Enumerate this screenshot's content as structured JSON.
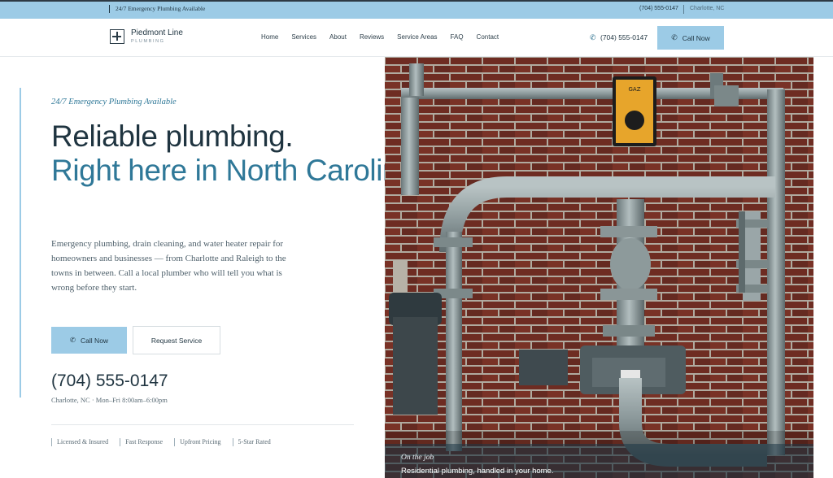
{
  "topbar": {
    "announcement": "24/7 Emergency Plumbing Available",
    "phone": "(704) 555-0147",
    "city": "Charlotte, NC"
  },
  "brand": {
    "name": "Piedmont Line",
    "tagline": "PLUMBING"
  },
  "nav": {
    "items": [
      "Home",
      "Services",
      "About",
      "Reviews",
      "Service Areas",
      "FAQ",
      "Contact"
    ]
  },
  "header": {
    "phone": "(704) 555-0147",
    "call_label": "Call Now"
  },
  "hero": {
    "eyebrow": "24/7 Emergency Plumbing Available",
    "headline_line1": "Reliable plumbing.",
    "headline_line2": "Right here in North Carolina.",
    "body": "Emergency plumbing, drain cleaning, and water heater repair for homeowners and businesses — from Charlotte and Raleigh to the towns in between. Call a local plumber who will tell you what is wrong before they start.",
    "call_label": "Call Now",
    "request_label": "Request Service",
    "phone": "(704) 555-0147",
    "hours": "Charlotte, NC · Mon–Fri 8:00am–6:00pm",
    "badges": [
      "Licensed & Insured",
      "Fast Response",
      "Upfront Pricing",
      "5-Star Rated"
    ]
  },
  "photo": {
    "caption_title": "On the job",
    "caption_text": "Residential plumbing, handled in your home."
  },
  "colors": {
    "accent": "#9ccbe6",
    "heading_dark": "#1f3440",
    "heading_blue": "#2f7898",
    "brick": "#7a3428"
  },
  "icons": {
    "phone": "phone-icon",
    "logo": "cross-square-logo-icon"
  }
}
